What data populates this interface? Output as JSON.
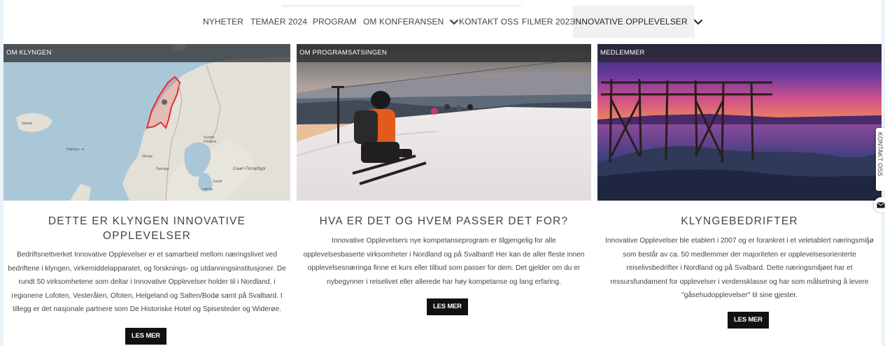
{
  "nav": {
    "items": [
      "NYHETER",
      "TEMAER 2024",
      "PROGRAM",
      "OM KONFERANSEN",
      "KONTAKT OSS",
      "FILMER 2023",
      "INNOVATIVE OPPLEVELSER"
    ]
  },
  "cards": [
    {
      "label": "OM KLYNGEN",
      "title": "DETTE ER KLYNGEN INNOVATIVE OPPLEVELSER",
      "text": "Bedriftsnettverket Innovative Opplevelser er et samarbeid mellom næringslivet ved bedriftene i klyngen, virkemiddelapparatet, og forsknings- og utdanningsinstitusjoner. De rundt 50 virksomhetene som deltar i Innovative Opplevelser holder til i Nordland, i regionene Lofoten, Vesterålen, Ofoten, Helgeland og Salten/Bodø samt på Svalbard. I tillegg er det nasjonale partnere som De Historiske Hotel og Spisesteder og Widerøe.",
      "button": "LES MER",
      "map_labels": [
        "Island",
        "Færøyene",
        "Norge",
        "Sverige",
        "Suomi Finland",
        "Eesti",
        "Latvija",
        "Санкт-Петербург"
      ]
    },
    {
      "label": "OM PROGRAMSATSINGEN",
      "title": "HVA ER DET OG HVEM PASSER DET FOR?",
      "text": "Innovative Opplevelsers nye kompetanseprogram er tilgjengelig for alle opplevelsesbaserte virksomheter i Nordland og på Svalbard! Her kan de aller fleste innen opplevelsesnæringa finne et kurs eller tilbud som passer for dem. Det gjelder om du er nybegynner i reiselivet eller allerede har høy kompetanse og lang erfaring.",
      "button": "LES MER"
    },
    {
      "label": "MEDLEMMER",
      "title": "KLYNGEBEDRIFTER",
      "text": "Innovative Opplevelser ble etablert i 2007 og er forankret i et veletablert næringsmiljø som består av ca. 50 medlemmer der majoriteten er opplevelsesorienterte reiselivsbedrifter i Nordland og på Svalbard. Dette næringsmiljøet har et ressursfundament for opplevelser i verdensklasse og har som målsetning å levere \"gåsehudopplevelser\" til sine gjester.",
      "button": "LES MER"
    }
  ],
  "side_tab": {
    "label": "KONTAKT OSS"
  },
  "icons": {
    "mail": "mail-icon",
    "chevron": "chevron-down-icon"
  }
}
